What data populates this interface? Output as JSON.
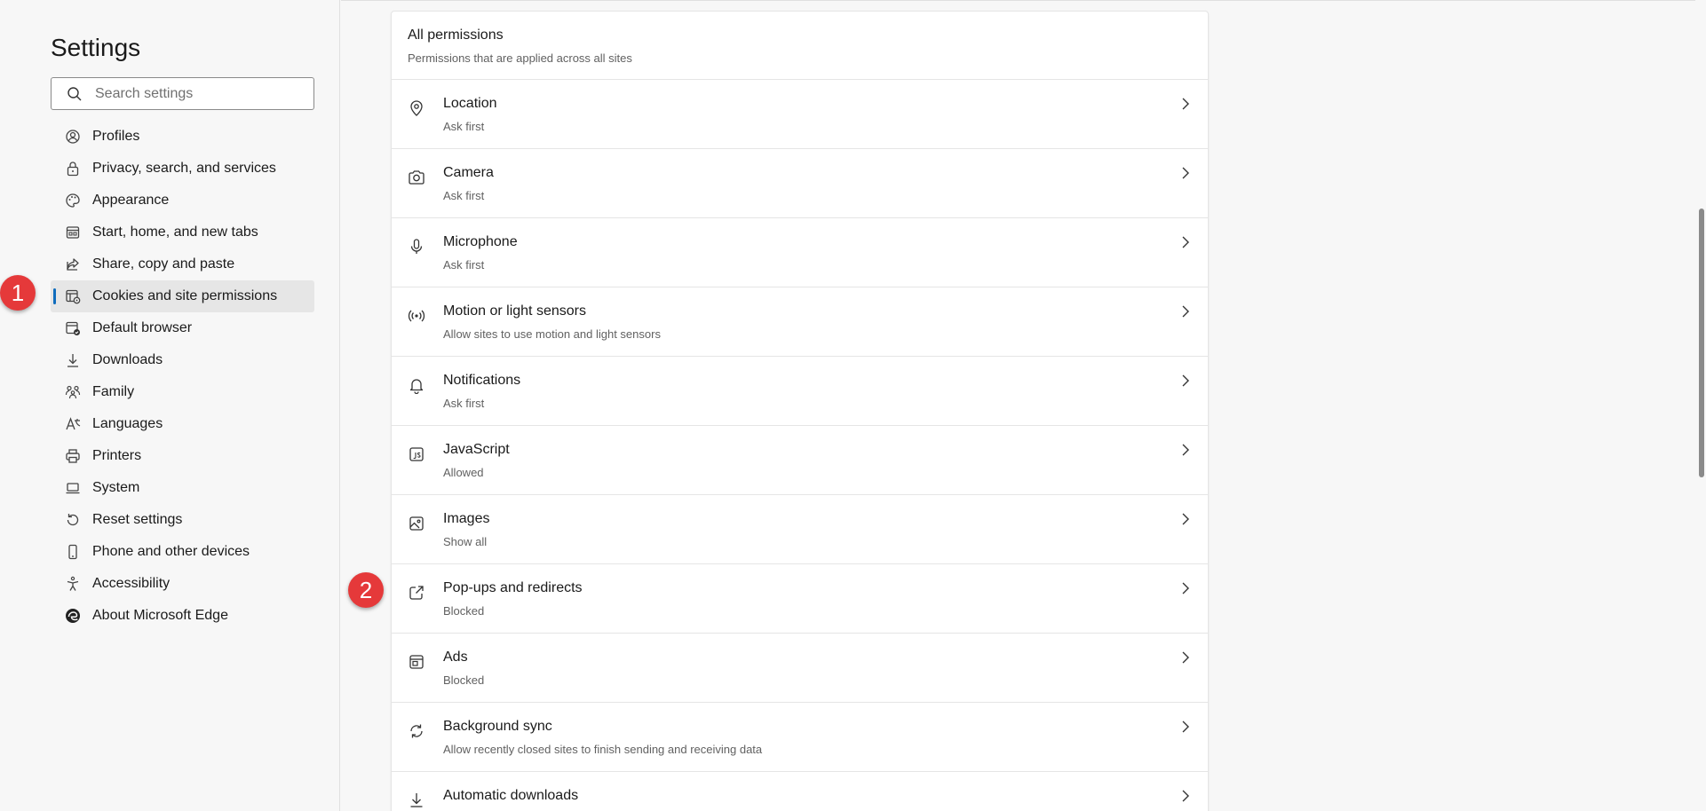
{
  "sidebar": {
    "title": "Settings",
    "search_placeholder": "Search settings",
    "items": [
      {
        "label": "Profiles",
        "icon": "profile-icon"
      },
      {
        "label": "Privacy, search, and services",
        "icon": "lock-icon"
      },
      {
        "label": "Appearance",
        "icon": "palette-icon"
      },
      {
        "label": "Start, home, and new tabs",
        "icon": "home-tabs-icon"
      },
      {
        "label": "Share, copy and paste",
        "icon": "share-icon"
      },
      {
        "label": "Cookies and site permissions",
        "icon": "cookies-permissions-icon",
        "active": true
      },
      {
        "label": "Default browser",
        "icon": "default-browser-icon"
      },
      {
        "label": "Downloads",
        "icon": "download-icon"
      },
      {
        "label": "Family",
        "icon": "family-icon"
      },
      {
        "label": "Languages",
        "icon": "languages-icon"
      },
      {
        "label": "Printers",
        "icon": "printer-icon"
      },
      {
        "label": "System",
        "icon": "laptop-icon"
      },
      {
        "label": "Reset settings",
        "icon": "reset-icon"
      },
      {
        "label": "Phone and other devices",
        "icon": "phone-icon"
      },
      {
        "label": "Accessibility",
        "icon": "accessibility-icon"
      },
      {
        "label": "About Microsoft Edge",
        "icon": "edge-logo-icon"
      }
    ]
  },
  "markers": {
    "one": "1",
    "two": "2"
  },
  "permissions": {
    "title": "All permissions",
    "subtitle": "Permissions that are applied across all sites",
    "items": [
      {
        "title": "Location",
        "desc": "Ask first",
        "icon": "location-pin-icon"
      },
      {
        "title": "Camera",
        "desc": "Ask first",
        "icon": "camera-icon"
      },
      {
        "title": "Microphone",
        "desc": "Ask first",
        "icon": "microphone-icon"
      },
      {
        "title": "Motion or light sensors",
        "desc": "Allow sites to use motion and light sensors",
        "icon": "sensor-icon"
      },
      {
        "title": "Notifications",
        "desc": "Ask first",
        "icon": "bell-icon"
      },
      {
        "title": "JavaScript",
        "desc": "Allowed",
        "icon": "javascript-icon"
      },
      {
        "title": "Images",
        "desc": "Show all",
        "icon": "image-icon"
      },
      {
        "title": "Pop-ups and redirects",
        "desc": "Blocked",
        "icon": "popup-icon"
      },
      {
        "title": "Ads",
        "desc": "Blocked",
        "icon": "ads-icon"
      },
      {
        "title": "Background sync",
        "desc": "Allow recently closed sites to finish sending and receiving data",
        "icon": "sync-icon"
      },
      {
        "title": "Automatic downloads",
        "desc": "",
        "icon": "download-icon"
      }
    ]
  },
  "colors": {
    "accent": "#0f6cbd",
    "marker": "#e5393a"
  }
}
